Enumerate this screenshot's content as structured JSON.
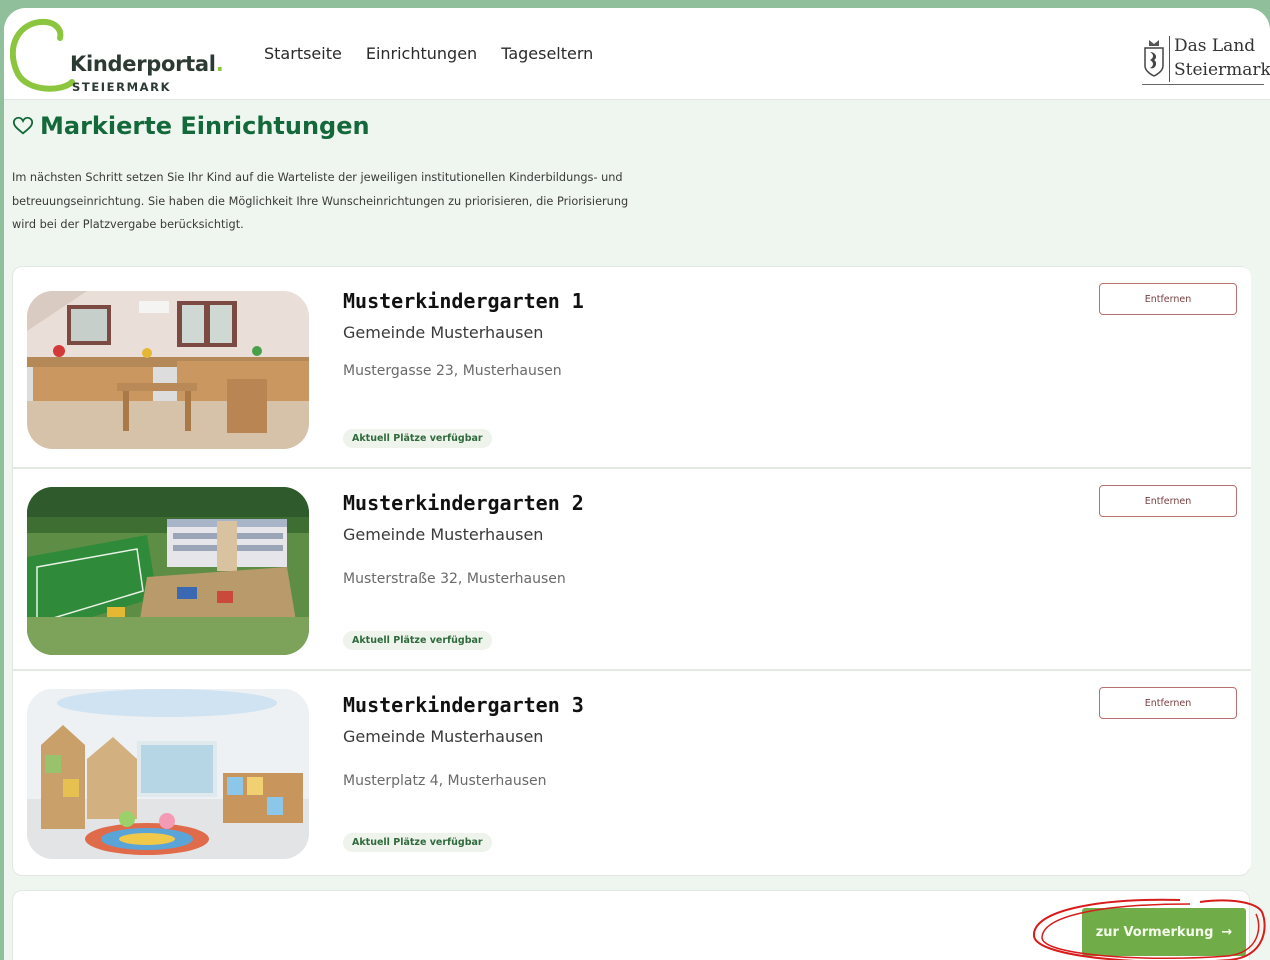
{
  "header": {
    "logo_name": "Kinderportal",
    "logo_dot": ".",
    "logo_sub": "STEIERMARK",
    "nav": [
      "Startseite",
      "Einrichtungen",
      "Tageseltern"
    ],
    "land_line1": "Das Land",
    "land_line2": "Steiermark"
  },
  "page": {
    "title": "Markierte Einrichtungen",
    "intro": "Im nächsten Schritt setzen Sie Ihr Kind auf die Warteliste der jeweiligen institutionellen Kinderbildungs- und betreuungseinrichtung. Sie haben die Möglichkeit Ihre Wunscheinrichtungen zu priorisieren, die Priorisierung wird bei der Platzvergabe berücksichtigt."
  },
  "facilities": [
    {
      "name": "Musterkindergarten 1",
      "municipality": "Gemeinde Musterhausen",
      "address": "Mustergasse 23, Musterhausen",
      "badge": "Aktuell Plätze verfügbar",
      "remove_label": "Entfernen"
    },
    {
      "name": "Musterkindergarten 2",
      "municipality": "Gemeinde Musterhausen",
      "address": "Musterstraße 32, Musterhausen",
      "badge": "Aktuell Plätze verfügbar",
      "remove_label": "Entfernen"
    },
    {
      "name": "Musterkindergarten 3",
      "municipality": "Gemeinde Musterhausen",
      "address": "Musterplatz 4, Musterhausen",
      "badge": "Aktuell Plätze verfügbar",
      "remove_label": "Entfernen"
    }
  ],
  "footer": {
    "cta_label": "zur Vormerkung",
    "cta_arrow": "→"
  },
  "colors": {
    "brand_green": "#14693b",
    "cta_green": "#70ad48",
    "remove_border": "#b86f70",
    "annotation_red": "#d81b1b",
    "backdrop": "#8fbf9b"
  },
  "icons": [
    "heart-outline-icon",
    "crest-icon",
    "arrow-right-icon"
  ]
}
